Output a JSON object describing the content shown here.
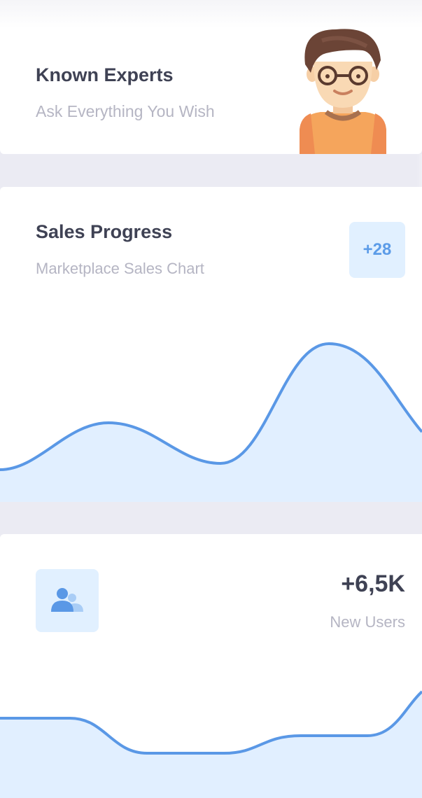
{
  "experts_card": {
    "title": "Known Experts",
    "subtitle": "Ask Everything You Wish",
    "illustration": "boy-with-glasses-avatar"
  },
  "sales_card": {
    "title": "Sales Progress",
    "subtitle": "Marketplace Sales Chart",
    "badge": "+28"
  },
  "users_card": {
    "value": "+6,5K",
    "label": "New Users",
    "icon": "group-icon"
  },
  "colors": {
    "primary": "#5a98e6",
    "primary_light": "#e1f0ff",
    "text_dark": "#3f4254",
    "text_muted": "#b5b5c3",
    "background": "#ebebf3",
    "card": "#ffffff"
  }
}
